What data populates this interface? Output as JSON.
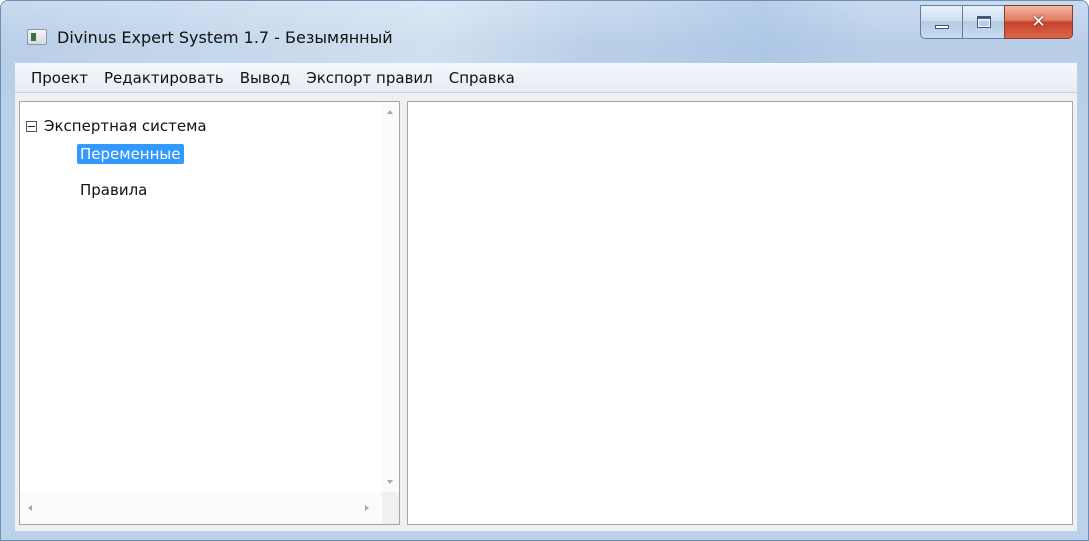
{
  "window": {
    "title": "Divinus Expert System 1.7 - Безымянный",
    "close_glyph": "✕"
  },
  "menu": {
    "items": [
      "Проект",
      "Редактировать",
      "Вывод",
      "Экспорт правил",
      "Справка"
    ]
  },
  "tree": {
    "root": {
      "label": "Экспертная система",
      "expanded": true
    },
    "children": [
      {
        "label": "Переменные",
        "selected": true
      },
      {
        "label": "Правила",
        "selected": false
      }
    ]
  },
  "icons": {
    "app": "app-icon",
    "minimize": "minimize-icon",
    "maximize": "maximize-icon",
    "close": "close-icon",
    "expander": "collapse-minus-icon"
  },
  "colors": {
    "selection": "#3399ff",
    "close_button": "#c6432a"
  }
}
